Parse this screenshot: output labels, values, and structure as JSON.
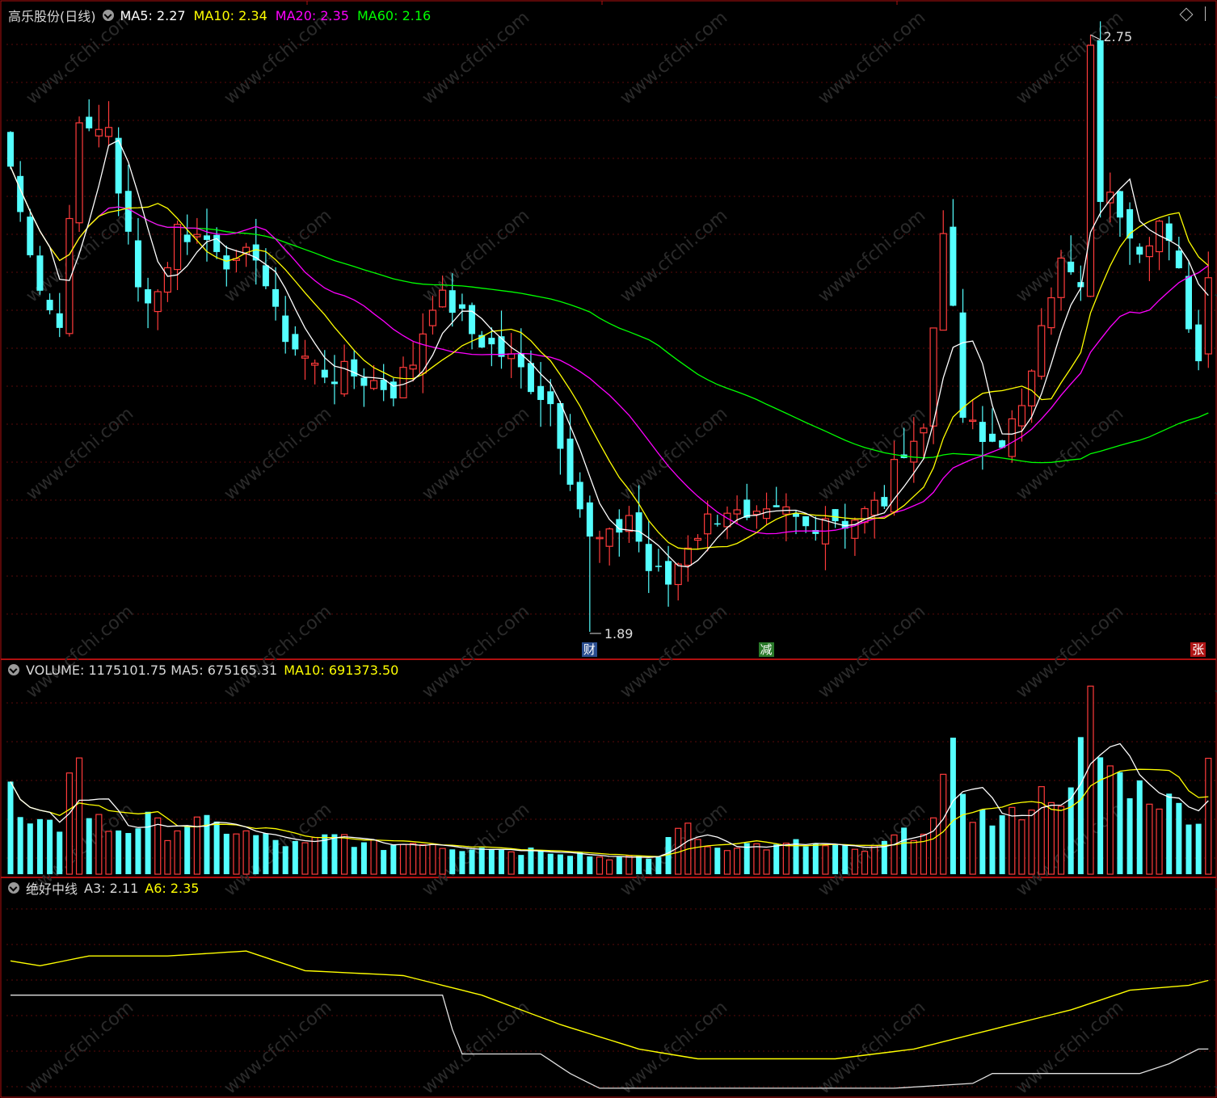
{
  "app": {
    "stock_name": "高乐股份",
    "period": "(日线)"
  },
  "price_panel": {
    "indicators": [
      {
        "name": "MA5",
        "value": "2.27",
        "color": "#ffffff"
      },
      {
        "name": "MA10",
        "value": "2.34",
        "color": "#ffff00"
      },
      {
        "name": "MA20",
        "value": "2.35",
        "color": "#ff00ff"
      },
      {
        "name": "MA60",
        "value": "2.16",
        "color": "#00ff00"
      }
    ],
    "high_label": "2.75",
    "low_label": "1.89",
    "events": [
      {
        "text": "财",
        "bg": "#2a4d8f",
        "index": 59
      },
      {
        "text": "减",
        "bg": "#2a7a2a",
        "index": 77
      },
      {
        "text": "张",
        "bg": "#b01515",
        "index": 121
      }
    ]
  },
  "volume_panel": {
    "label": "VOLUME:",
    "value": "1175101.75",
    "ma5_label": "MA5:",
    "ma5_value": "675165.31",
    "ma10_label": "MA10:",
    "ma10_value": "691373.50"
  },
  "indicator_panel": {
    "name": "绝好中线",
    "a3_label": "A3:",
    "a3_value": "2.11",
    "a6_label": "A6:",
    "a6_value": "2.35"
  },
  "colors": {
    "up": "#ff3b3b",
    "down": "#54ffff",
    "frame": "#b01010",
    "grid": "#5a0a0a",
    "ma5": "#ffffff",
    "ma10": "#ffff00",
    "ma20": "#ff00ff",
    "ma60": "#00ff00"
  },
  "chart_data": {
    "type": "candlestick",
    "price_range": [
      1.89,
      2.75
    ],
    "anchors": {
      "close": [
        [
          0,
          2.56
        ],
        [
          2,
          2.43
        ],
        [
          5,
          2.33
        ],
        [
          7,
          2.64
        ],
        [
          8,
          2.6
        ],
        [
          10,
          2.62
        ],
        [
          11,
          2.53
        ],
        [
          13,
          2.38
        ],
        [
          15,
          2.38
        ],
        [
          17,
          2.47
        ],
        [
          19,
          2.46
        ],
        [
          21,
          2.45
        ],
        [
          23,
          2.41
        ],
        [
          25,
          2.44
        ],
        [
          27,
          2.34
        ],
        [
          29,
          2.3
        ],
        [
          31,
          2.27
        ],
        [
          33,
          2.26
        ],
        [
          35,
          2.26
        ],
        [
          37,
          2.25
        ],
        [
          39,
          2.24
        ],
        [
          41,
          2.28
        ],
        [
          43,
          2.37
        ],
        [
          45,
          2.36
        ],
        [
          47,
          2.32
        ],
        [
          49,
          2.3
        ],
        [
          51,
          2.28
        ],
        [
          53,
          2.25
        ],
        [
          55,
          2.22
        ],
        [
          57,
          2.12
        ],
        [
          59,
          2.02
        ],
        [
          61,
          2.02
        ],
        [
          63,
          2.06
        ],
        [
          65,
          1.98
        ],
        [
          67,
          1.96
        ],
        [
          69,
          2.02
        ],
        [
          71,
          2.05
        ],
        [
          73,
          2.07
        ],
        [
          75,
          2.04
        ],
        [
          77,
          2.05
        ],
        [
          79,
          2.06
        ],
        [
          81,
          2.04
        ],
        [
          83,
          2.06
        ],
        [
          85,
          2.05
        ],
        [
          87,
          2.06
        ],
        [
          89,
          2.08
        ],
        [
          91,
          2.16
        ],
        [
          93,
          2.18
        ],
        [
          95,
          2.48
        ],
        [
          97,
          2.2
        ],
        [
          99,
          2.16
        ],
        [
          101,
          2.17
        ],
        [
          103,
          2.2
        ],
        [
          105,
          2.35
        ],
        [
          107,
          2.42
        ],
        [
          109,
          2.38
        ],
        [
          110,
          2.72
        ],
        [
          111,
          2.52
        ],
        [
          113,
          2.5
        ],
        [
          115,
          2.45
        ],
        [
          117,
          2.48
        ],
        [
          119,
          2.4
        ],
        [
          121,
          2.28
        ],
        [
          122,
          2.4
        ]
      ],
      "vol": [
        [
          0,
          0.44
        ],
        [
          1,
          0.29
        ],
        [
          2,
          0.24
        ],
        [
          5,
          0.25
        ],
        [
          6,
          0.61
        ],
        [
          7,
          0.57
        ],
        [
          8,
          0.32
        ],
        [
          10,
          0.24
        ],
        [
          12,
          0.24
        ],
        [
          14,
          0.28
        ],
        [
          16,
          0.22
        ],
        [
          18,
          0.27
        ],
        [
          20,
          0.26
        ],
        [
          22,
          0.24
        ],
        [
          24,
          0.21
        ],
        [
          26,
          0.19
        ],
        [
          28,
          0.16
        ],
        [
          30,
          0.15
        ],
        [
          32,
          0.19
        ],
        [
          34,
          0.2
        ],
        [
          36,
          0.15
        ],
        [
          38,
          0.15
        ],
        [
          40,
          0.16
        ],
        [
          42,
          0.18
        ],
        [
          44,
          0.15
        ],
        [
          46,
          0.14
        ],
        [
          48,
          0.16
        ],
        [
          50,
          0.13
        ],
        [
          52,
          0.12
        ],
        [
          54,
          0.14
        ],
        [
          56,
          0.12
        ],
        [
          58,
          0.11
        ],
        [
          60,
          0.09
        ],
        [
          62,
          0.09
        ],
        [
          64,
          0.08
        ],
        [
          66,
          0.09
        ],
        [
          68,
          0.28
        ],
        [
          70,
          0.18
        ],
        [
          72,
          0.14
        ],
        [
          74,
          0.16
        ],
        [
          76,
          0.15
        ],
        [
          78,
          0.14
        ],
        [
          80,
          0.16
        ],
        [
          82,
          0.15
        ],
        [
          84,
          0.14
        ],
        [
          86,
          0.12
        ],
        [
          88,
          0.13
        ],
        [
          90,
          0.19
        ],
        [
          92,
          0.22
        ],
        [
          94,
          0.28
        ],
        [
          96,
          0.6
        ],
        [
          98,
          0.33
        ],
        [
          100,
          0.28
        ],
        [
          102,
          0.3
        ],
        [
          104,
          0.38
        ],
        [
          106,
          0.44
        ],
        [
          108,
          0.4
        ],
        [
          110,
          0.88
        ],
        [
          111,
          0.62
        ],
        [
          113,
          0.5
        ],
        [
          115,
          0.45
        ],
        [
          117,
          0.4
        ],
        [
          119,
          0.35
        ],
        [
          121,
          0.3
        ],
        [
          122,
          0.58
        ]
      ],
      "a3": [
        [
          0,
          2.35
        ],
        [
          44,
          2.35
        ],
        [
          45,
          2.28
        ],
        [
          46,
          2.23
        ],
        [
          54,
          2.23
        ],
        [
          57,
          2.19
        ],
        [
          60,
          2.16
        ],
        [
          69,
          2.16
        ],
        [
          90,
          2.16
        ],
        [
          98,
          2.17
        ],
        [
          100,
          2.19
        ],
        [
          115,
          2.19
        ],
        [
          118,
          2.21
        ],
        [
          121,
          2.24
        ],
        [
          122,
          2.24
        ]
      ],
      "a6": [
        [
          0,
          2.42
        ],
        [
          3,
          2.41
        ],
        [
          8,
          2.43
        ],
        [
          16,
          2.43
        ],
        [
          24,
          2.44
        ],
        [
          30,
          2.4
        ],
        [
          40,
          2.39
        ],
        [
          48,
          2.35
        ],
        [
          56,
          2.29
        ],
        [
          64,
          2.24
        ],
        [
          70,
          2.22
        ],
        [
          76,
          2.22
        ],
        [
          84,
          2.22
        ],
        [
          92,
          2.24
        ],
        [
          100,
          2.28
        ],
        [
          108,
          2.32
        ],
        [
          114,
          2.36
        ],
        [
          120,
          2.37
        ],
        [
          122,
          2.38
        ]
      ]
    }
  }
}
